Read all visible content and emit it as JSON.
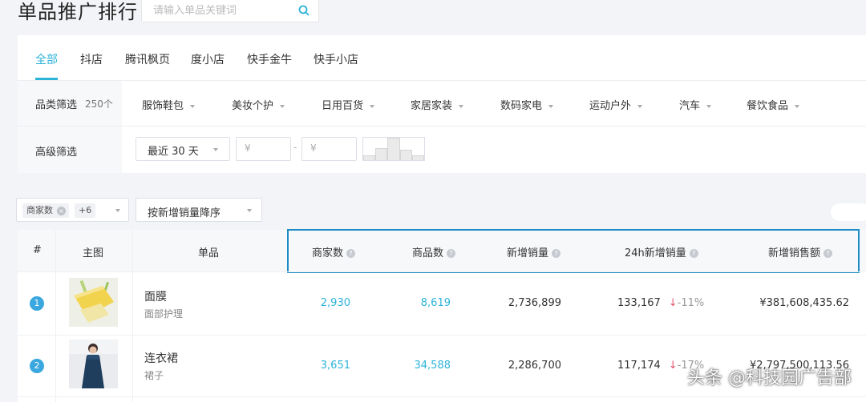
{
  "page": {
    "title": "单品推广排行"
  },
  "search": {
    "placeholder": "请输入单品关键词"
  },
  "tabs": [
    {
      "label": "全部",
      "active": true
    },
    {
      "label": "抖店"
    },
    {
      "label": "腾讯枫页"
    },
    {
      "label": "度小店"
    },
    {
      "label": "快手金牛"
    },
    {
      "label": "快手小店"
    }
  ],
  "category_filter": {
    "label": "品类筛选",
    "count": "250个",
    "items": [
      "服饰鞋包",
      "美妆个护",
      "日用百货",
      "家居家装",
      "数码家电",
      "运动户外",
      "汽车",
      "餐饮食品"
    ]
  },
  "advanced_filter": {
    "label": "高级筛选",
    "date_range": "最近 30 天",
    "price_min_placeholder": "¥",
    "price_max_placeholder": "¥",
    "dash": "-"
  },
  "histogram": {
    "levels": [
      0.2,
      0.55,
      1.0,
      0.45,
      0.2
    ]
  },
  "toolbar": {
    "column_chip": "商家数",
    "more_chip": "+6",
    "sort_label": "按新增销量降序"
  },
  "table": {
    "headers": {
      "rank": "#",
      "image": "主图",
      "product": "单品",
      "merchants": "商家数",
      "items": "商品数",
      "new_sales": "新增销量",
      "sales_24h": "24h新增销量",
      "new_revenue": "新增销售额"
    },
    "rows": [
      {
        "rank": "1",
        "name": "面膜",
        "category": "面部护理",
        "merchants": "2,930",
        "items": "8,619",
        "new_sales": "2,736,899",
        "sales_24h": "133,167",
        "change": "-11%",
        "revenue": "¥381,608,435.62"
      },
      {
        "rank": "2",
        "name": "连衣裙",
        "category": "裙子",
        "merchants": "3,651",
        "items": "34,588",
        "new_sales": "2,286,700",
        "sales_24h": "117,174",
        "change": "-17%",
        "revenue": "¥2,797,500,113.56"
      }
    ]
  },
  "watermark": "头条 @科技园广告部",
  "colors": {
    "accent": "#2bb3d8",
    "rank_badge": "#3aa7df",
    "highlight_border": "#1e8cc4",
    "down": "#e4526c"
  }
}
